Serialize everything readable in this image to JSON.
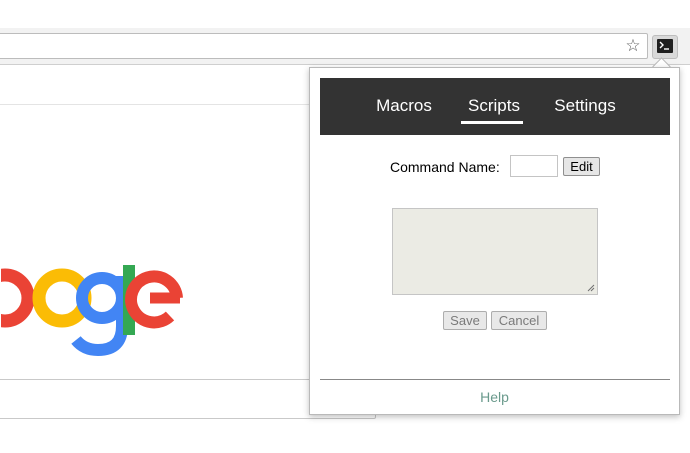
{
  "browser": {
    "bookmark_icon": "star-icon",
    "extension_icon": "terminal-icon"
  },
  "page": {
    "logo_text": "ogle"
  },
  "popup": {
    "tabs": [
      {
        "label": "Macros",
        "active": false
      },
      {
        "label": "Scripts",
        "active": true
      },
      {
        "label": "Settings",
        "active": false
      }
    ],
    "command_name_label": "Command Name:",
    "command_name_value": "",
    "edit_label": "Edit",
    "script_value": "",
    "save_label": "Save",
    "cancel_label": "Cancel",
    "help_label": "Help",
    "colors": {
      "nav_background": "#333333",
      "help_link": "#6a9a8c",
      "textarea_background": "#ebebe4"
    }
  }
}
